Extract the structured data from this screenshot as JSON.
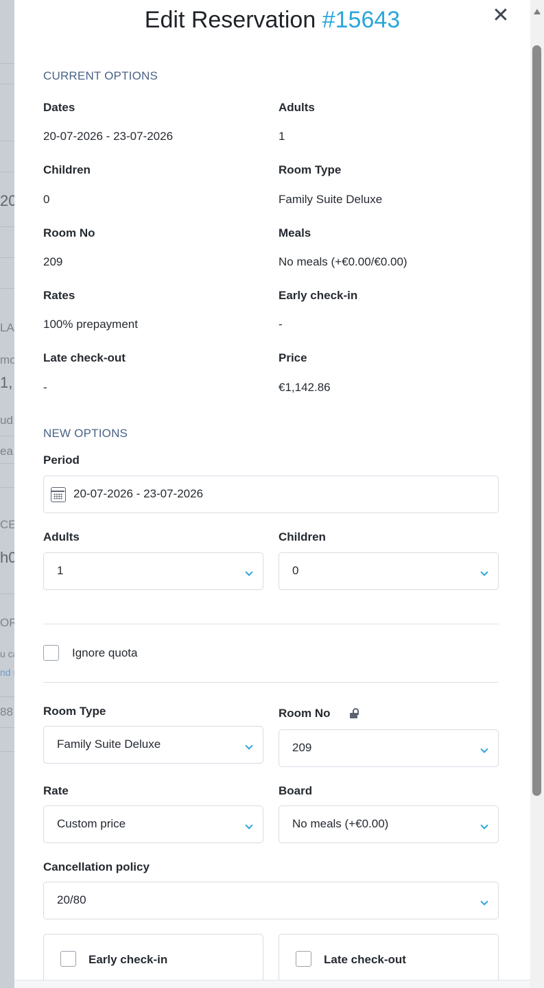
{
  "background": {
    "fragments": [
      "20",
      "LA",
      "mo",
      "1,",
      "ud",
      "ea",
      "CE",
      "h0",
      "OR",
      "u ca",
      "nd r",
      "88"
    ]
  },
  "modal": {
    "title": "Edit Reservation",
    "reservation_number": "#15643",
    "close_icon": "close-icon",
    "current_options": {
      "heading": "CURRENT OPTIONS",
      "fields": [
        {
          "label": "Dates",
          "value": "20-07-2026 - 23-07-2026"
        },
        {
          "label": "Adults",
          "value": "1"
        },
        {
          "label": "Children",
          "value": "0"
        },
        {
          "label": "Room Type",
          "value": "Family Suite Deluxe"
        },
        {
          "label": "Room No",
          "value": "209"
        },
        {
          "label": "Meals",
          "value": "No meals (+€0.00/€0.00)"
        },
        {
          "label": "Rates",
          "value": "100% prepayment"
        },
        {
          "label": "Early check-in",
          "value": "-"
        },
        {
          "label": "Late check-out",
          "value": "-"
        },
        {
          "label": "Price",
          "value": "€1,142.86"
        }
      ]
    },
    "new_options": {
      "heading": "NEW OPTIONS",
      "period": {
        "label": "Period",
        "value": "20-07-2026 - 23-07-2026",
        "icon": "calendar-icon"
      },
      "adults": {
        "label": "Adults",
        "value": "1"
      },
      "children": {
        "label": "Children",
        "value": "0"
      },
      "ignore_quota": {
        "label": "Ignore quota",
        "checked": false
      },
      "room_type": {
        "label": "Room Type",
        "value": "Family Suite Deluxe"
      },
      "room_no": {
        "label": "Room No",
        "value": "209",
        "icon": "unlock-icon"
      },
      "rate": {
        "label": "Rate",
        "value": "Custom price"
      },
      "board": {
        "label": "Board",
        "value": "No meals (+€0.00)"
      },
      "cancellation_policy": {
        "label": "Cancellation policy",
        "value": "20/80"
      },
      "early_checkin": {
        "label": "Early check-in",
        "checked": false
      },
      "late_checkout": {
        "label": "Late check-out",
        "checked": false
      }
    }
  },
  "colors": {
    "accent": "#2aa6d9",
    "section_heading": "#4a6385",
    "text": "#252a30",
    "border": "#d6dbe1"
  }
}
